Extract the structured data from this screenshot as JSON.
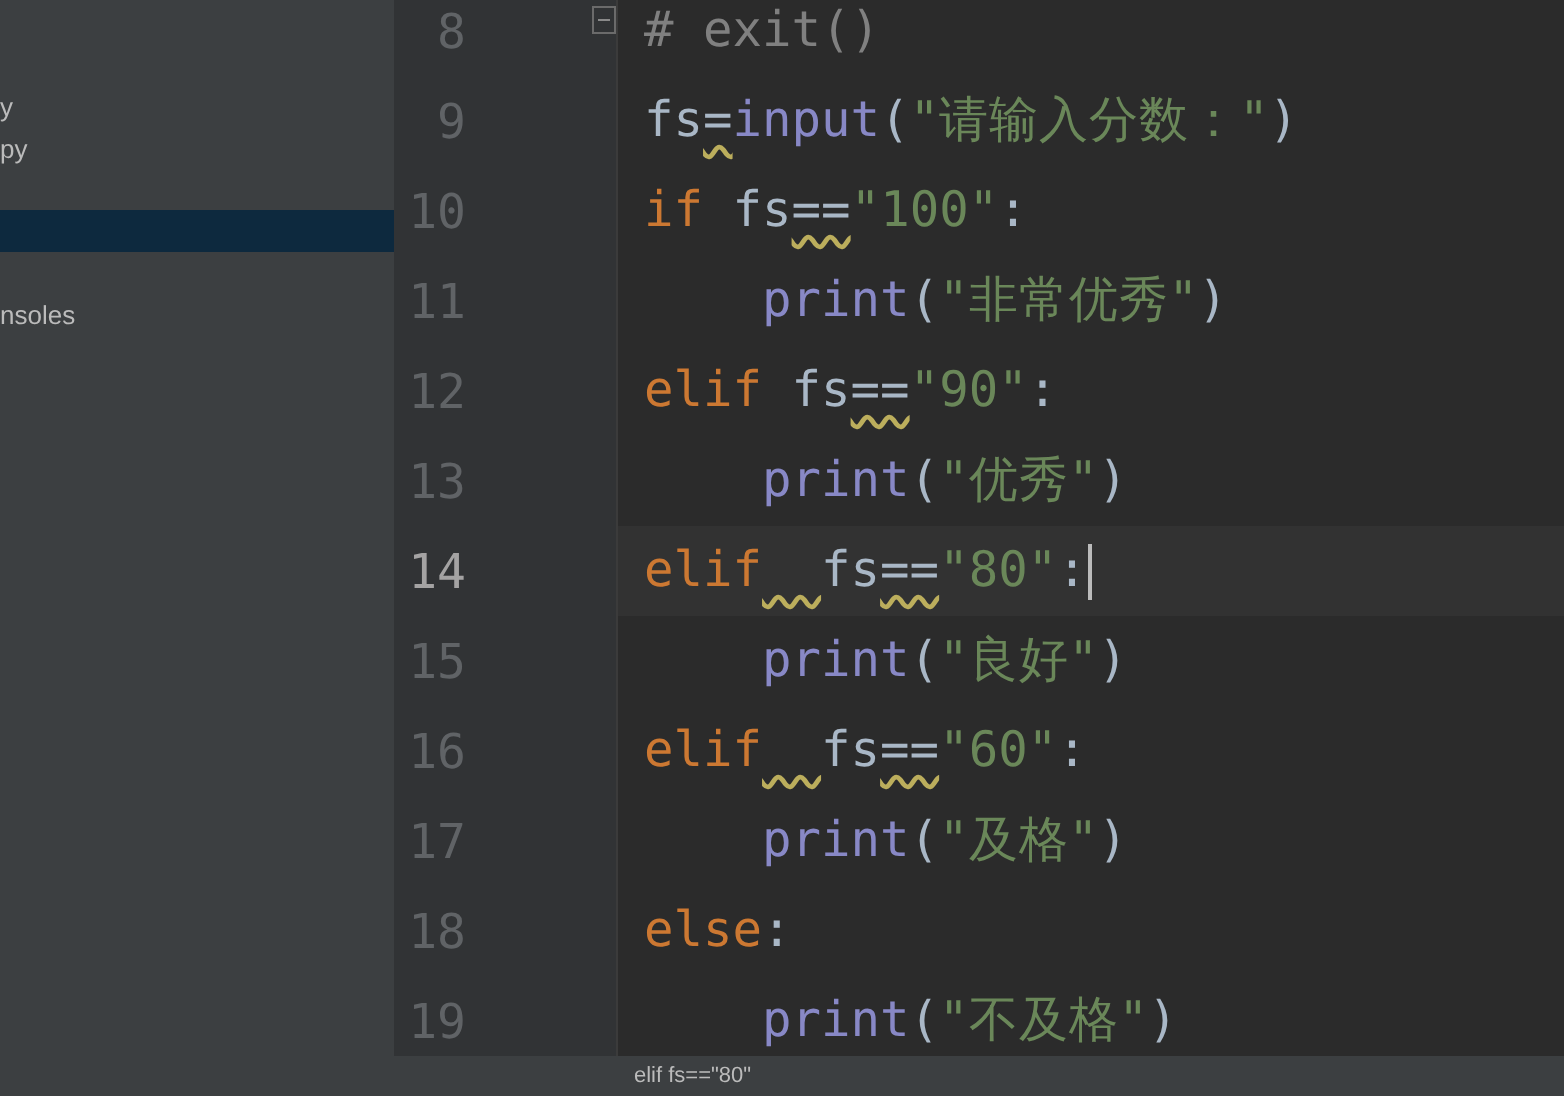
{
  "sidebar": {
    "items": [
      {
        "label": "y",
        "selected": false
      },
      {
        "label": "py",
        "selected": false
      },
      {
        "selected": true
      },
      {
        "label": "nsoles",
        "selected": false
      }
    ]
  },
  "editor": {
    "lines": [
      {
        "number": "8",
        "current": false,
        "foldable": true,
        "indent": false,
        "tokens": [
          {
            "text": "# exit()",
            "kind": "comment",
            "warning": false
          }
        ]
      },
      {
        "number": "9",
        "current": false,
        "foldable": false,
        "indent": false,
        "tokens": [
          {
            "text": "fs",
            "kind": "name",
            "warning": false
          },
          {
            "text": "=",
            "kind": "name",
            "warning": true
          },
          {
            "text": "input",
            "kind": "builtin",
            "warning": false
          },
          {
            "text": "(",
            "kind": "name",
            "warning": false
          },
          {
            "text": "\"请输入分数：\"",
            "kind": "string",
            "warning": false
          },
          {
            "text": ")",
            "kind": "name",
            "warning": false
          }
        ]
      },
      {
        "number": "10",
        "current": false,
        "foldable": false,
        "indent": false,
        "tokens": [
          {
            "text": "if",
            "kind": "keyword",
            "warning": false
          },
          {
            "kind": "space",
            "warning": false
          },
          {
            "text": "fs",
            "kind": "name",
            "warning": false
          },
          {
            "text": "==",
            "kind": "name",
            "warning": true
          },
          {
            "text": "\"100\"",
            "kind": "string",
            "warning": false
          },
          {
            "text": ":",
            "kind": "name",
            "warning": false
          }
        ]
      },
      {
        "number": "11",
        "current": false,
        "foldable": false,
        "indent": true,
        "tokens": [
          {
            "text": "print",
            "kind": "builtin",
            "warning": false
          },
          {
            "text": "(",
            "kind": "name",
            "warning": false
          },
          {
            "text": "\"非常优秀\"",
            "kind": "string",
            "warning": false
          },
          {
            "text": ")",
            "kind": "name",
            "warning": false
          }
        ]
      },
      {
        "number": "12",
        "current": false,
        "foldable": false,
        "indent": false,
        "tokens": [
          {
            "text": "elif",
            "kind": "keyword",
            "warning": false
          },
          {
            "kind": "space",
            "warning": false
          },
          {
            "text": "fs",
            "kind": "name",
            "warning": false
          },
          {
            "text": "==",
            "kind": "name",
            "warning": true
          },
          {
            "text": "\"90\"",
            "kind": "string",
            "warning": false
          },
          {
            "text": ":",
            "kind": "name",
            "warning": false
          }
        ]
      },
      {
        "number": "13",
        "current": false,
        "foldable": false,
        "indent": true,
        "tokens": [
          {
            "text": "print",
            "kind": "builtin",
            "warning": false
          },
          {
            "text": "(",
            "kind": "name",
            "warning": false
          },
          {
            "text": "\"优秀\"",
            "kind": "string",
            "warning": false
          },
          {
            "text": ")",
            "kind": "name",
            "warning": false
          }
        ]
      },
      {
        "number": "14",
        "current": true,
        "foldable": false,
        "indent": false,
        "tokens": [
          {
            "text": "elif",
            "kind": "keyword",
            "warning": false
          },
          {
            "kind": "space",
            "warning": true
          },
          {
            "text": "fs",
            "kind": "name",
            "warning": false
          },
          {
            "text": "==",
            "kind": "name",
            "warning": true
          },
          {
            "text": "\"80\"",
            "kind": "string",
            "warning": false
          },
          {
            "text": ":",
            "kind": "name",
            "warning": false
          }
        ]
      },
      {
        "number": "15",
        "current": false,
        "foldable": false,
        "indent": true,
        "tokens": [
          {
            "text": "print",
            "kind": "builtin",
            "warning": false
          },
          {
            "text": "(",
            "kind": "name",
            "warning": false
          },
          {
            "text": "\"良好\"",
            "kind": "string",
            "warning": false
          },
          {
            "text": ")",
            "kind": "name",
            "warning": false
          }
        ]
      },
      {
        "number": "16",
        "current": false,
        "foldable": false,
        "indent": false,
        "tokens": [
          {
            "text": "elif",
            "kind": "keyword",
            "warning": false
          },
          {
            "kind": "space",
            "warning": true
          },
          {
            "text": "fs",
            "kind": "name",
            "warning": false
          },
          {
            "text": "==",
            "kind": "name",
            "warning": true
          },
          {
            "text": "\"60\"",
            "kind": "string",
            "warning": false
          },
          {
            "text": ":",
            "kind": "name",
            "warning": false
          }
        ]
      },
      {
        "number": "17",
        "current": false,
        "foldable": false,
        "indent": true,
        "tokens": [
          {
            "text": "print",
            "kind": "builtin",
            "warning": false
          },
          {
            "text": "(",
            "kind": "name",
            "warning": false
          },
          {
            "text": "\"及格\"",
            "kind": "string",
            "warning": false
          },
          {
            "text": ")",
            "kind": "name",
            "warning": false
          }
        ]
      },
      {
        "number": "18",
        "current": false,
        "foldable": false,
        "indent": false,
        "tokens": [
          {
            "text": "else",
            "kind": "keyword",
            "warning": false
          },
          {
            "text": ":",
            "kind": "name",
            "warning": false
          }
        ]
      },
      {
        "number": "19",
        "current": false,
        "foldable": false,
        "indent": true,
        "tokens": [
          {
            "text": "print",
            "kind": "builtin",
            "warning": false
          },
          {
            "text": "(",
            "kind": "name",
            "warning": false
          },
          {
            "text": "\"不及格\"",
            "kind": "string",
            "warning": false
          },
          {
            "text": ")",
            "kind": "name",
            "warning": false
          }
        ]
      }
    ]
  },
  "breadcrumb": "elif fs==\"80\""
}
